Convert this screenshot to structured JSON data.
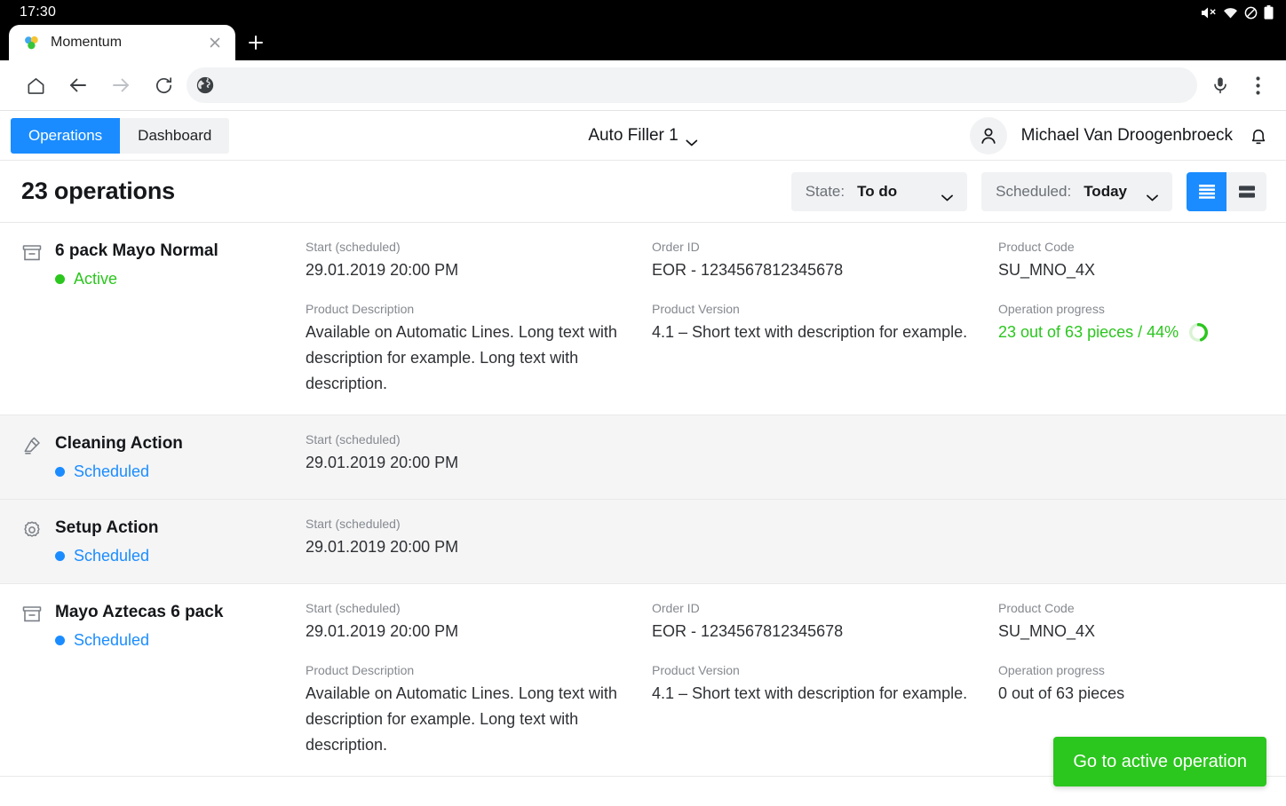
{
  "statusbar": {
    "time": "17:30",
    "icons": [
      "volume-mute-icon",
      "wifi-icon",
      "do-not-disturb-icon",
      "battery-icon"
    ]
  },
  "browser": {
    "tab": {
      "title": "Momentum",
      "favicon": "momentum-favicon",
      "close": "close-icon"
    },
    "new_tab": "+",
    "nav": {
      "home": "home-icon",
      "back": "back-arrow-icon",
      "forward": "forward-arrow-icon",
      "reload": "reload-icon"
    },
    "omnibox": {
      "icon": "globe-icon",
      "value": "",
      "placeholder": ""
    },
    "mic": "microphone-icon",
    "menu": "kebab-menu-icon"
  },
  "app": {
    "tabs": [
      {
        "label": "Operations",
        "active": true
      },
      {
        "label": "Dashboard",
        "active": false
      }
    ],
    "machine": {
      "label": "Auto Filler 1",
      "chevron": "chevron-down-icon"
    },
    "user": {
      "name": "Michael Van Droogenbroeck",
      "avatar": "person-icon",
      "bell": "bell-icon"
    }
  },
  "toolbar": {
    "title": "23 operations",
    "filters": [
      {
        "label": "State:",
        "value": "To do"
      },
      {
        "label": "Scheduled:",
        "value": "Today"
      }
    ],
    "views": [
      {
        "name": "compact-list-view",
        "active": true
      },
      {
        "name": "comfortable-list-view",
        "active": false
      }
    ]
  },
  "colors": {
    "accent_blue": "#1a8cff",
    "status_blue": "#1a8cff",
    "status_green": "#2bc61e",
    "fab_green": "#2bc61e",
    "row_shade": "#f5f5f6"
  },
  "labels": {
    "start": "Start (scheduled)",
    "order_id": "Order ID",
    "product_code": "Product Code",
    "product_description": "Product Description",
    "product_version": "Product Version",
    "operation_progress": "Operation progress"
  },
  "operations": [
    {
      "icon": "box-icon",
      "title": "6 pack Mayo Normal",
      "state": "Active",
      "state_color": "#2bc61e",
      "shaded": false,
      "start": "29.01.2019 20:00 PM",
      "order_id": "EOR - 1234567812345678",
      "product_code": "SU_MNO_4X",
      "product_description": "Available on Automatic Lines. Long text with description for example. Long text with description.",
      "product_version": "4.1 – Short text with description for example.",
      "progress_text": "23 out of 63 pieces / 44%",
      "progress_percent": 44,
      "progress_green": true,
      "has_details": true
    },
    {
      "icon": "brush-icon",
      "title": "Cleaning Action",
      "state": "Scheduled",
      "state_color": "#1a8cff",
      "shaded": true,
      "start": "29.01.2019 20:00 PM",
      "has_details": false
    },
    {
      "icon": "gear-icon",
      "title": "Setup Action",
      "state": "Scheduled",
      "state_color": "#1a8cff",
      "shaded": true,
      "start": "29.01.2019 20:00 PM",
      "has_details": false
    },
    {
      "icon": "box-icon",
      "title": "Mayo Aztecas 6 pack",
      "state": "Scheduled",
      "state_color": "#1a8cff",
      "shaded": false,
      "start": "29.01.2019 20:00 PM",
      "order_id": "EOR - 1234567812345678",
      "product_code": "SU_MNO_4X",
      "product_description": "Available on Automatic Lines. Long text with description for example. Long text with description.",
      "product_version": "4.1 – Short text with description for example.",
      "progress_text": "0 out of 63 pieces",
      "progress_percent": 0,
      "progress_green": false,
      "has_details": true
    }
  ],
  "fab": {
    "label": "Go to active operation"
  }
}
